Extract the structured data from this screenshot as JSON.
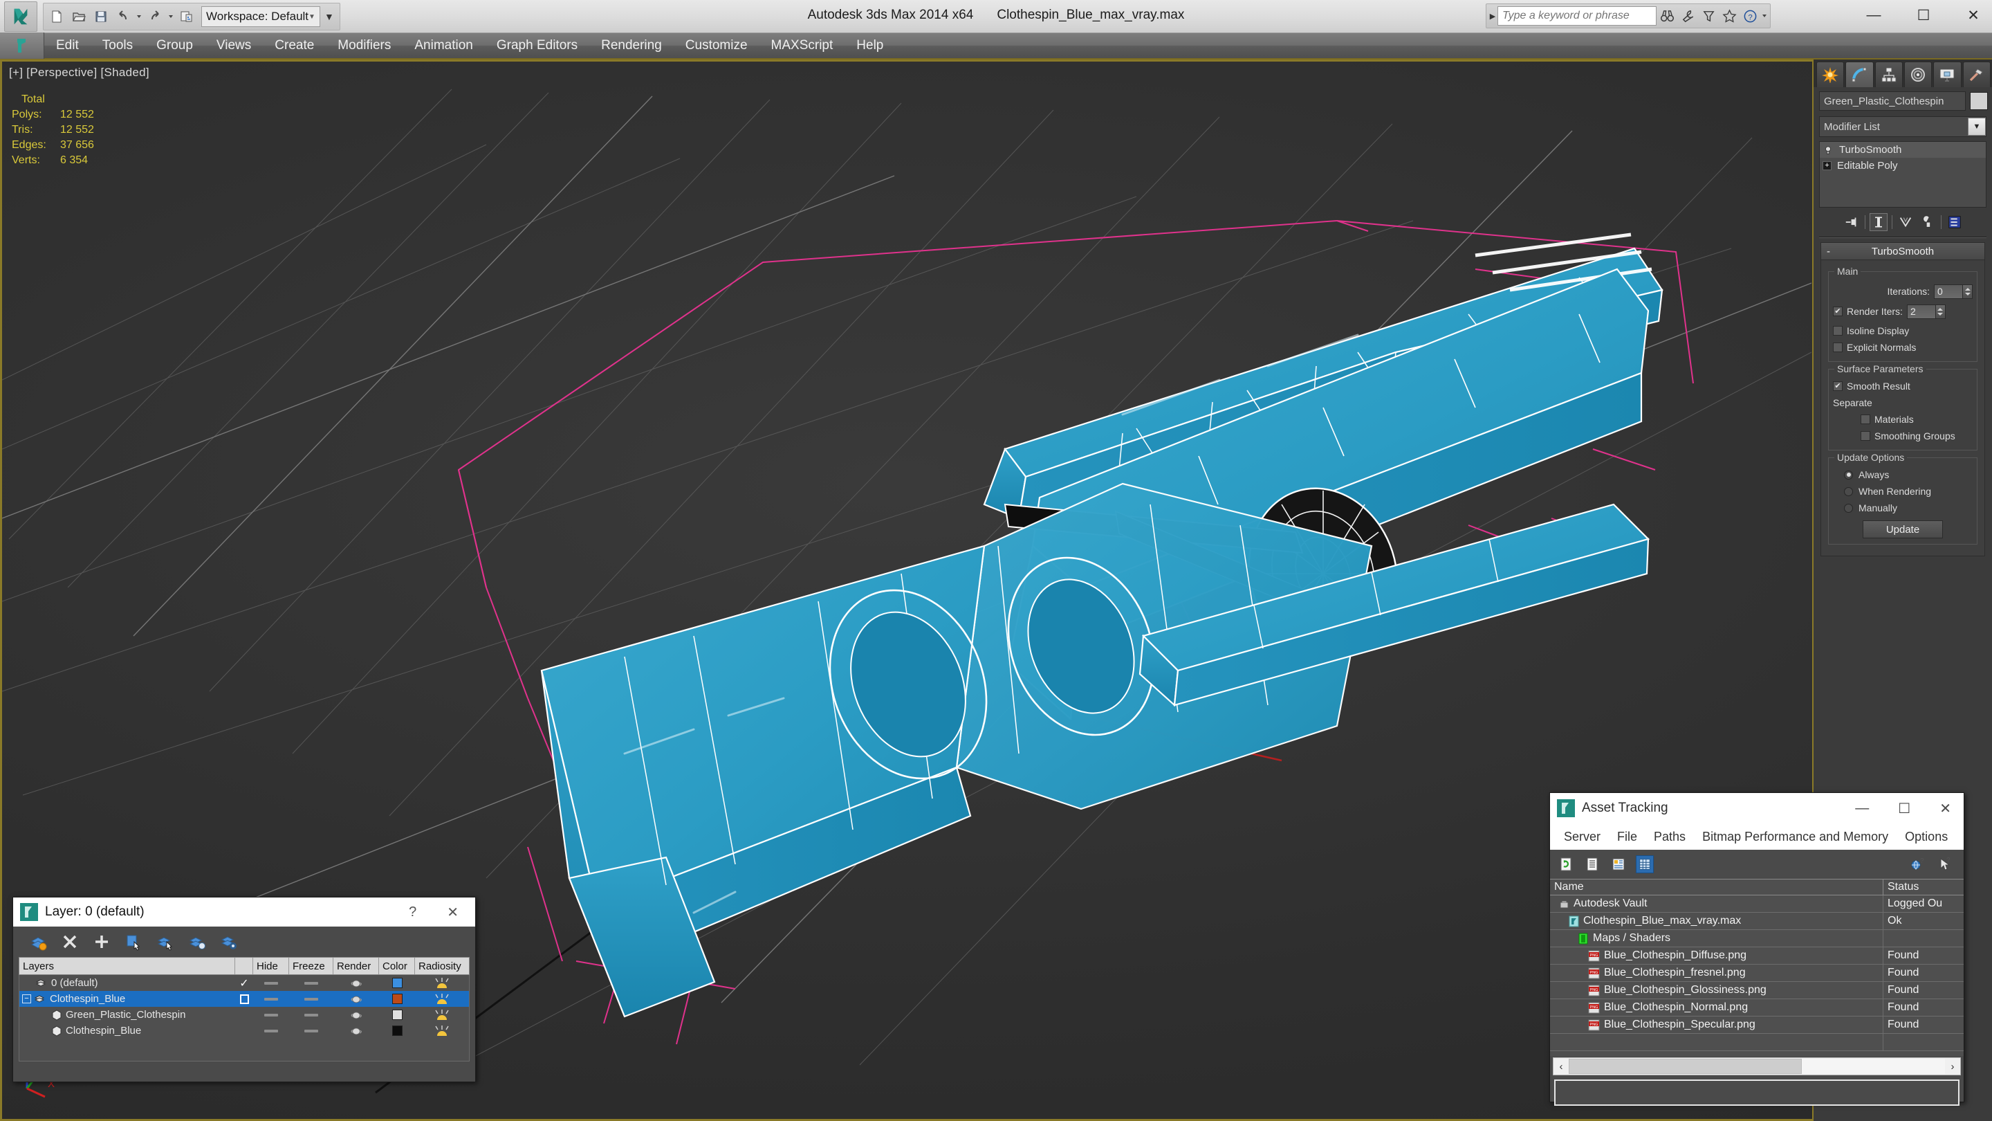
{
  "titlebar": {
    "app_title": "Autodesk 3ds Max  2014 x64",
    "file_title": "Clothespin_Blue_max_vray.max",
    "workspace": "Workspace: Default",
    "search_placeholder": "Type a keyword or phrase",
    "quick_access": [
      {
        "name": "new-file",
        "label": "New"
      },
      {
        "name": "open-file",
        "label": "Open"
      },
      {
        "name": "save-file",
        "label": "Save"
      },
      {
        "name": "undo",
        "label": "Undo"
      },
      {
        "name": "redo",
        "label": "Redo"
      },
      {
        "name": "set-project-folder",
        "label": "Set Project Folder"
      }
    ],
    "search_icons": [
      "binoculars-icon",
      "wrench-icon",
      "funnel-icon",
      "star-icon",
      "help-icon"
    ],
    "window_buttons": {
      "minimize": "—",
      "maximize": "☐",
      "close": "✕"
    }
  },
  "menubar": {
    "items": [
      "Edit",
      "Tools",
      "Group",
      "Views",
      "Create",
      "Modifiers",
      "Animation",
      "Graph Editors",
      "Rendering",
      "Customize",
      "MAXScript",
      "Help"
    ]
  },
  "viewport": {
    "label": "[+] [Perspective] [Shaded]",
    "stats": {
      "header": "Total",
      "rows": [
        {
          "label": "Polys:",
          "value": "12 552"
        },
        {
          "label": "Tris:",
          "value": "12 552"
        },
        {
          "label": "Edges:",
          "value": "37 656"
        },
        {
          "label": "Verts:",
          "value": "6 354"
        }
      ]
    },
    "axis": {
      "x": "X",
      "y": "Y",
      "z": "Z"
    },
    "model_color": "#2b9cc4",
    "wire_color": "#ffffff",
    "gizmo_color": "#e0328c",
    "background_color": "#2e2e2e"
  },
  "command_panel": {
    "tabs": [
      {
        "name": "create-tab",
        "icon": "star-burst-icon",
        "active": false
      },
      {
        "name": "modify-tab",
        "icon": "bent-arc-icon",
        "active": true
      },
      {
        "name": "hierarchy-tab",
        "icon": "hierarchy-icon",
        "active": false
      },
      {
        "name": "motion-tab",
        "icon": "motion-wheel-icon",
        "active": false
      },
      {
        "name": "display-tab",
        "icon": "monitor-icon",
        "active": false
      },
      {
        "name": "utilities-tab",
        "icon": "hammer-icon",
        "active": false
      }
    ],
    "object_name": "Green_Plastic_Clothespin",
    "modifier_list_label": "Modifier List",
    "stack": [
      {
        "label": "TurboSmooth",
        "selected": true,
        "icon": "lightbulb-icon"
      },
      {
        "label": "Editable Poly",
        "selected": false,
        "icon": "plus-box-icon"
      }
    ],
    "stack_buttons": [
      "pin-stack-icon",
      "show-end-result-icon",
      "make-unique-icon",
      "remove-modifier-icon",
      "configure-sets-icon"
    ],
    "rollout": {
      "title": "TurboSmooth",
      "collapse_sign": "-",
      "groups": [
        {
          "title": "Main",
          "fields": [
            {
              "type": "spinner",
              "label": "Iterations:",
              "value": "0"
            },
            {
              "type": "check-spinner",
              "label": "Render Iters:",
              "value": "2",
              "checked": true
            },
            {
              "type": "checkbox",
              "label": "Isoline Display",
              "checked": false
            },
            {
              "type": "checkbox",
              "label": "Explicit Normals",
              "checked": false
            }
          ]
        },
        {
          "title": "Surface Parameters",
          "fields": [
            {
              "type": "checkbox",
              "label": "Smooth Result",
              "checked": true
            },
            {
              "type": "text",
              "label": "Separate"
            },
            {
              "type": "checkbox-indent",
              "label": "Materials",
              "checked": false
            },
            {
              "type": "checkbox-indent",
              "label": "Smoothing Groups",
              "checked": false
            }
          ]
        },
        {
          "title": "Update Options",
          "fields": [
            {
              "type": "radio",
              "label": "Always",
              "checked": true
            },
            {
              "type": "radio",
              "label": "When Rendering",
              "checked": false
            },
            {
              "type": "radio",
              "label": "Manually",
              "checked": false
            }
          ],
          "button": "Update"
        }
      ]
    }
  },
  "layer_dialog": {
    "title": "Layer: 0 (default)",
    "help_label": "?",
    "close_label": "✕",
    "toolbar": [
      "new-layer-icon",
      "delete-layer-icon",
      "add-layer-icon",
      "select-objects-icon",
      "select-highlighted-icon",
      "highlight-selected-icon",
      "layer-properties-icon"
    ],
    "columns": [
      "Layers",
      "",
      "Hide",
      "Freeze",
      "Render",
      "Color",
      "Radiosity"
    ],
    "rows": [
      {
        "name": "0 (default)",
        "indent": 0,
        "icon": "layer-icon",
        "active_mark": "✓",
        "hide": "dash",
        "freeze": "dash",
        "render": "teapot",
        "color": "#3b8fe0",
        "radiosity": "radiosity-icon",
        "selected": false,
        "expander": ""
      },
      {
        "name": "Clothespin_Blue",
        "indent": 0,
        "icon": "layer-icon",
        "active_mark": "box",
        "hide": "dash",
        "freeze": "dash",
        "render": "teapot",
        "color": "#bd4a18",
        "radiosity": "radiosity-icon",
        "selected": true,
        "expander": "minus"
      },
      {
        "name": "Green_Plastic_Clothespin",
        "indent": 1,
        "icon": "object-icon",
        "active_mark": "",
        "hide": "dash",
        "freeze": "dash",
        "render": "teapot",
        "color": "#e0e0e0",
        "radiosity": "radiosity-icon",
        "selected": false,
        "expander": ""
      },
      {
        "name": "Clothespin_Blue",
        "indent": 1,
        "icon": "object-icon",
        "active_mark": "",
        "hide": "dash",
        "freeze": "dash",
        "render": "teapot",
        "color": "#0d0d0d",
        "radiosity": "radiosity-icon",
        "selected": false,
        "expander": ""
      }
    ]
  },
  "asset_tracking": {
    "title": "Asset Tracking",
    "window_buttons": {
      "minimize": "—",
      "maximize": "☐",
      "close": "✕"
    },
    "menu": [
      "Server",
      "File",
      "Paths",
      "Bitmap Performance and Memory",
      "Options"
    ],
    "toolbar_left": [
      "refresh-icon",
      "list-view-icon",
      "details-view-icon",
      "grid-view-icon"
    ],
    "toolbar_right": [
      "help-globe-icon",
      "help-pointer-icon"
    ],
    "columns": {
      "name": "Name",
      "status": "Status"
    },
    "rows": [
      {
        "name": "Autodesk Vault",
        "status": "Logged Ou",
        "indent": 0,
        "icon": "vault-icon"
      },
      {
        "name": "Clothespin_Blue_max_vray.max",
        "status": "Ok",
        "indent": 1,
        "icon": "max-file-icon"
      },
      {
        "name": "Maps / Shaders",
        "status": "",
        "indent": 2,
        "icon": "maps-icon"
      },
      {
        "name": "Blue_Clothespin_Diffuse.png",
        "status": "Found",
        "indent": 3,
        "icon": "png-icon"
      },
      {
        "name": "Blue_Clothespin_fresnel.png",
        "status": "Found",
        "indent": 3,
        "icon": "png-icon"
      },
      {
        "name": "Blue_Clothespin_Glossiness.png",
        "status": "Found",
        "indent": 3,
        "icon": "png-icon"
      },
      {
        "name": "Blue_Clothespin_Normal.png",
        "status": "Found",
        "indent": 3,
        "icon": "png-icon"
      },
      {
        "name": "Blue_Clothespin_Specular.png",
        "status": "Found",
        "indent": 3,
        "icon": "png-icon"
      },
      {
        "name": "",
        "status": "",
        "indent": 0,
        "icon": ""
      }
    ],
    "scroll_left": "‹",
    "scroll_right": "›"
  }
}
